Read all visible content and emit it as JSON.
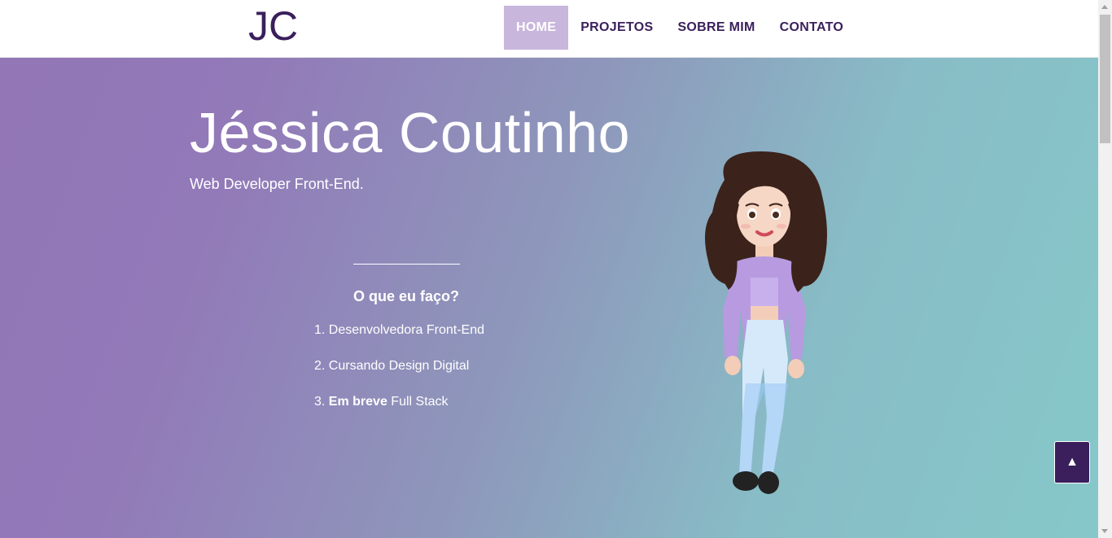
{
  "header": {
    "logo": "JC",
    "nav": [
      {
        "label": "HOME",
        "active": true
      },
      {
        "label": "PROJETOS",
        "active": false
      },
      {
        "label": "SOBRE MIM",
        "active": false
      },
      {
        "label": "CONTATO",
        "active": false
      }
    ]
  },
  "hero": {
    "title": "Jéssica Coutinho",
    "subtitle": "Web Developer Front-End.",
    "what_title": "O que eu faço?",
    "skills": [
      {
        "number": "1.",
        "bold": "",
        "text": "Desenvolvedora Front-End"
      },
      {
        "number": "2.",
        "bold": "",
        "text": "Cursando Design Digital"
      },
      {
        "number": "3.",
        "bold": "Em breve",
        "text": " Full Stack"
      }
    ]
  },
  "back_to_top": {
    "icon": "triangle-up-icon",
    "label": "▲"
  },
  "colors": {
    "brand": "#3a1f5c",
    "nav_active": "#c8b6dc",
    "gradient_start": "#9276b6",
    "gradient_end": "#86c8c9"
  }
}
